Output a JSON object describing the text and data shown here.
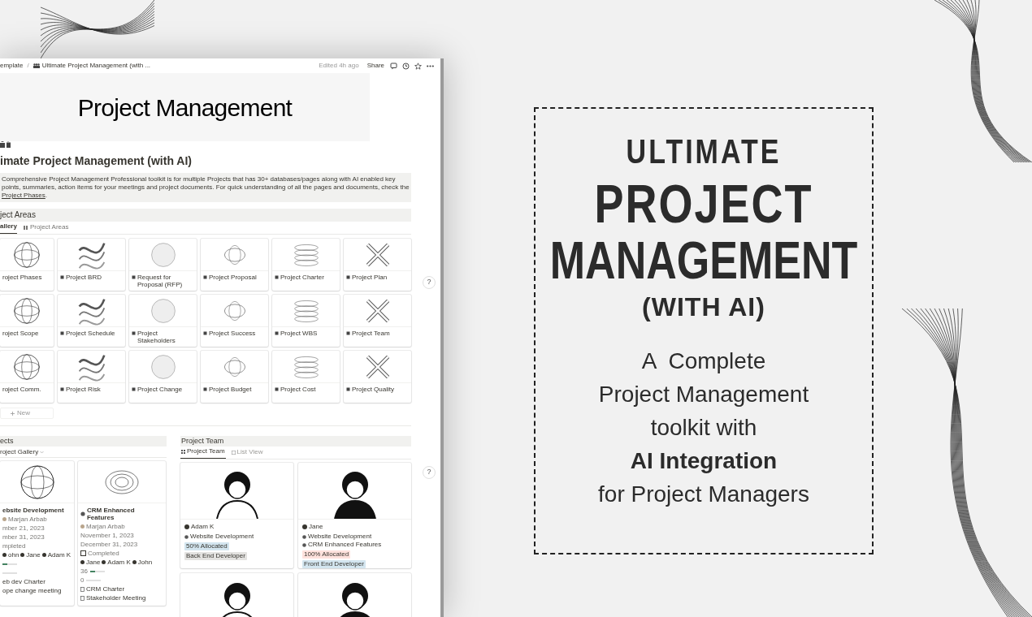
{
  "topbar": {
    "breadcrumb": [
      "emplate",
      "Ultimate Project Management (with ..."
    ],
    "separator": "/",
    "edited": "Edited 4h ago",
    "share": "Share"
  },
  "cover": {
    "title": "Project Management"
  },
  "page": {
    "title": "imate Project Management (with AI)",
    "callout": {
      "text": "Comprehensive Project Management Professional toolkit is for multiple Projects that has 30+ databases/pages along with AI enabled key points, summaries, action items for your meetings and project documents. For quick understanding of all the pages and documents, check the",
      "link": "Project Phases",
      "after": "."
    }
  },
  "project_areas": {
    "heading": "ject Areas",
    "tabs": [
      {
        "label": "allery",
        "selected": true
      },
      {
        "label": "Project Areas",
        "selected": false
      }
    ],
    "cards": [
      {
        "title": "roject Phases"
      },
      {
        "title": "Project BRD"
      },
      {
        "title": "Request for Proposal (RFP)"
      },
      {
        "title": "Project Proposal"
      },
      {
        "title": "Project Charter"
      },
      {
        "title": "Project Plan"
      },
      {
        "title": "roject Scope"
      },
      {
        "title": "Project Schedule"
      },
      {
        "title": "Project Stakeholders"
      },
      {
        "title": "Project Success"
      },
      {
        "title": "Project WBS"
      },
      {
        "title": "Project Team"
      },
      {
        "title": "roject Comm."
      },
      {
        "title": "Project Risk"
      },
      {
        "title": "Project Change"
      },
      {
        "title": "Project Budget"
      },
      {
        "title": "Project Cost"
      },
      {
        "title": "Project Quality"
      }
    ],
    "new_button": "New"
  },
  "projects": {
    "heading": "ects",
    "view": "roject Gallery",
    "cards": [
      {
        "title": "ebsite Development",
        "owner": "Marjan Arbab",
        "start": "mber 21, 2023",
        "end": "mber 31, 2023",
        "status": "mpleted",
        "people": [
          "ohn",
          "Jane",
          "Adam K"
        ],
        "progress": [
          {
            "level": 0.35
          },
          {
            "level": 0
          }
        ],
        "docs": [
          "eb dev Charter",
          "ope change meeting"
        ]
      },
      {
        "title": "CRM Enhanced Features",
        "owner": "Marjan Arbab",
        "start": "November 1, 2023",
        "end": "December 31, 2023",
        "status": "Completed",
        "checked": false,
        "people": [
          "Jane",
          "Adam K",
          "John"
        ],
        "progress": [
          {
            "reading": "36",
            "level": 0.36
          },
          {
            "reading": "0",
            "level": 0
          }
        ],
        "docs": [
          "CRM Charter",
          "Stakeholder Meeting"
        ]
      }
    ]
  },
  "team": {
    "heading": "Project Team",
    "tabs": [
      {
        "label": "Project Team",
        "selected": true
      },
      {
        "label": "List View",
        "selected": false
      }
    ],
    "members": [
      {
        "kind": "full",
        "name": "Adam K",
        "projects": [
          "Website Development"
        ],
        "tags": [
          {
            "label": "50% Allocated",
            "color": "#d3e5ef"
          },
          {
            "label": "Back End Developer",
            "color": "#e3e2e0"
          }
        ]
      },
      {
        "kind": "full",
        "name": "Jane",
        "projects": [
          "Website Development",
          "CRM Enhanced Features"
        ],
        "tags": [
          {
            "label": "100% Allocated",
            "color": "#ffe2dd"
          },
          {
            "label": "Front End Developer",
            "color": "#d3e5ef"
          }
        ]
      },
      {
        "kind": "partial"
      },
      {
        "kind": "partial"
      }
    ]
  },
  "help": [
    "?",
    "?"
  ],
  "promo": {
    "line_1": "ULTIMATE",
    "line_2": "PROJECT",
    "line_3": "MANAGEMENT",
    "line_4": "(WITH AI)",
    "tagline": [
      "A  Complete",
      "Project Management",
      "toolkit with",
      "AI Integration",
      "for Project Managers"
    ]
  }
}
